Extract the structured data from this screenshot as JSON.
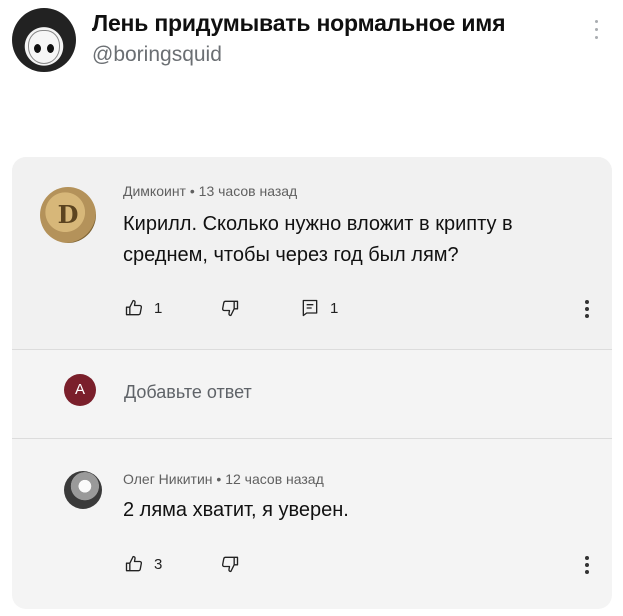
{
  "tweet": {
    "display_name": "Лень придумывать нормальное имя",
    "handle": "@boringsquid"
  },
  "comment": {
    "author": "Димкоинт",
    "separator": "•",
    "time": "13 часов назад",
    "avatar_letter": "D",
    "text_line1": "Кирилл. Сколько нужно вложит в крипту в",
    "text_line2": "среднем, чтобы через год был лям?",
    "likes": "1",
    "replies": "1"
  },
  "reply_box": {
    "avatar_letter": "A",
    "placeholder": "Добавьте ответ"
  },
  "reply": {
    "author": "Олег Никитин",
    "separator": "•",
    "time": "12 часов назад",
    "text": "2 ляма хватит, я уверен.",
    "likes": "3"
  },
  "colors": {
    "reply_avatar_bg": "#7a1f2b",
    "card_bg": "#f4f4f4",
    "handle": "#6b6f73"
  }
}
